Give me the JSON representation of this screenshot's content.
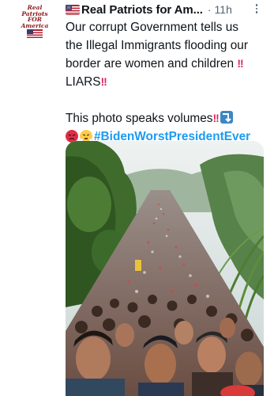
{
  "avatar": {
    "logo_lines": [
      "Real",
      "Patriots",
      "FOR",
      "America"
    ]
  },
  "header": {
    "name": "Real Patriots for Am...",
    "separator": "·",
    "time": "11h"
  },
  "tweet": {
    "lines": [
      "Our corrupt Government tells us",
      "the Illegal Immigrants flooding our",
      "border are women and children",
      "LIARS",
      "This photo speaks volumes"
    ],
    "exclamation": "!!",
    "hashtag": "#BidenWorstPresidentEver"
  },
  "icons": {
    "flag": "us-flag-icon",
    "more": "more-options-icon",
    "double_exclamation": "double-exclamation-icon",
    "right_arrow_curving_down": "arrow-curving-down-icon",
    "angry_face": "angry-face-icon",
    "steam_face": "face-with-steam-icon"
  },
  "colors": {
    "text": "#0f1419",
    "secondary": "#536471",
    "link": "#1d9bf0",
    "exclamation": "#e0245e",
    "logo_red": "#8b1a1a"
  }
}
